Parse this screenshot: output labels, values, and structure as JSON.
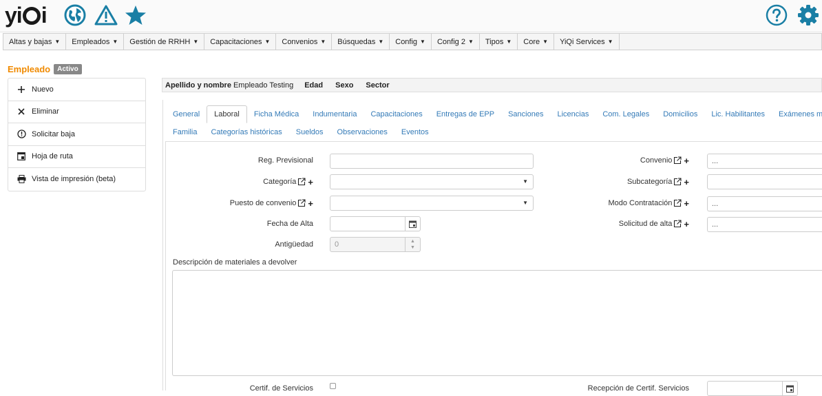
{
  "logo": {
    "left": "yi",
    "right": "i"
  },
  "menu": [
    {
      "label": "Altas y bajas"
    },
    {
      "label": "Empleados"
    },
    {
      "label": "Gestión de RRHH"
    },
    {
      "label": "Capacitaciones"
    },
    {
      "label": "Convenios"
    },
    {
      "label": "Búsquedas"
    },
    {
      "label": "Config"
    },
    {
      "label": "Config 2"
    },
    {
      "label": "Tipos"
    },
    {
      "label": "Core"
    },
    {
      "label": "YiQi Services"
    }
  ],
  "employee": {
    "title": "Empleado",
    "status": "Activo"
  },
  "side_actions": [
    {
      "label": "Nuevo",
      "icon": "plus-icon"
    },
    {
      "label": "Eliminar",
      "icon": "close-icon"
    },
    {
      "label": "Solicitar baja",
      "icon": "alert-circle-icon"
    },
    {
      "label": "Hoja de ruta",
      "icon": "route-sheet-icon"
    },
    {
      "label": "Vista de impresión (beta)",
      "icon": "printer-icon"
    }
  ],
  "strip": {
    "name_label": "Apellido y nombre",
    "name_value": "Empleado Testing",
    "age_label": "Edad",
    "sex_label": "Sexo",
    "sector_label": "Sector"
  },
  "tabs_row1": [
    "General",
    "Laboral",
    "Ficha Médica",
    "Indumentaria",
    "Capacitaciones",
    "Entregas de EPP",
    "Sanciones",
    "Licencias",
    "Com. Legales",
    "Domicilios",
    "Lic. Habilitantes",
    "Exámenes médicos"
  ],
  "tabs_row2": [
    "Familia",
    "Categorías históricas",
    "Sueldos",
    "Observaciones",
    "Eventos"
  ],
  "active_tab": "Laboral",
  "form": {
    "reg_previsional": {
      "label": "Reg. Previsional",
      "value": ""
    },
    "categoria": {
      "label": "Categoría",
      "value": ""
    },
    "puesto_convenio": {
      "label": "Puesto de convenio",
      "value": ""
    },
    "fecha_alta": {
      "label": "Fecha de Alta",
      "value": ""
    },
    "antiguedad": {
      "label": "Antigüedad",
      "value": "0"
    },
    "convenio": {
      "label": "Convenio",
      "value": "..."
    },
    "subcategoria": {
      "label": "Subcategoría",
      "value": ""
    },
    "modo_contratacion": {
      "label": "Modo Contratación",
      "value": "..."
    },
    "solicitud_alta": {
      "label": "Solicitud de alta",
      "value": "..."
    },
    "descripcion": {
      "label": "Descripción de materiales a devolver",
      "value": ""
    },
    "certif_servicios": {
      "label": "Certif. de Servicios"
    },
    "recepcion_certif": {
      "label": "Recepción de Certif. Servicios",
      "value": ""
    }
  },
  "colors": {
    "accent": "#1a7fa5",
    "orange": "#f08a00",
    "link": "#337ab7"
  }
}
